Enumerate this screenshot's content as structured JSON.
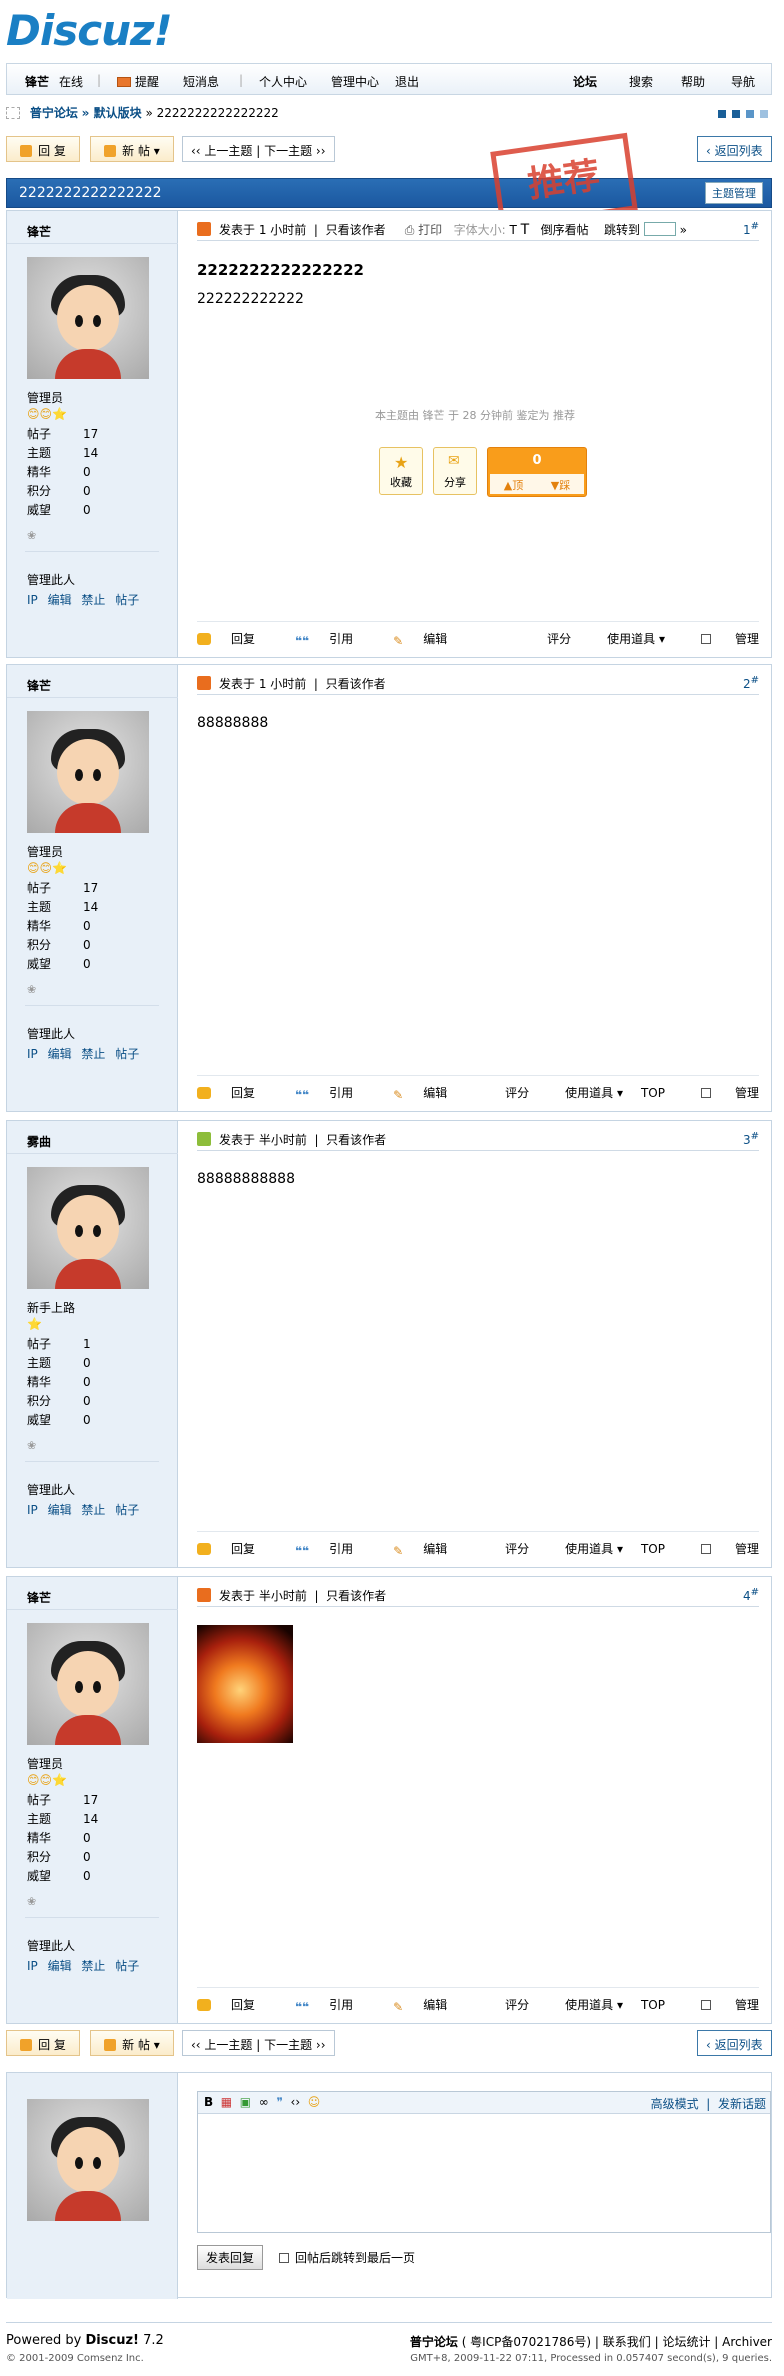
{
  "logo": "Discuz!",
  "topbar": {
    "user": "锋芒",
    "online": "在线",
    "reminder": "提醒",
    "pm": "短消息",
    "ucenter": "个人中心",
    "admincp": "管理中心",
    "logout": "退出",
    "forum": "论坛",
    "search": "搜索",
    "help": "帮助",
    "nav": "导航"
  },
  "crumb": {
    "site": "普宁论坛",
    "board": "» 默认版块",
    "thread": "» 2222222222222222"
  },
  "buttons": {
    "reply": "回 复",
    "newpost": "新 帖",
    "prevnext": "‹‹ 上一主题 | 下一主题 ››",
    "back": "‹ 返回列表"
  },
  "thread": {
    "title": "2222222222222222",
    "manage": "主题管理",
    "stamp": "推荐"
  },
  "labels": {
    "posts": "帖子",
    "threads": "主题",
    "digest": "精华",
    "credits": "积分",
    "prestige": "威望",
    "manage_user": "管理此人",
    "mlinks": "IP 编辑 禁止 帖子",
    "posted": "发表于",
    "only_author": "只看该作者",
    "print": "打印",
    "font": "字体大小:",
    "t": "T",
    "t2": "T",
    "reverse": "倒序看帖",
    "jump": "跳转到",
    "reply": "回复",
    "quote": "引用",
    "edit": "编辑",
    "rate": "评分",
    "tools": "使用道具",
    "top": "TOP",
    "admin": "管理",
    "fav": "收藏",
    "share": "分享",
    "up": "顶",
    "down": "踩"
  },
  "thread_hint": "本主题由 锋芒 于 28 分钟前 鉴定为 推荐",
  "posts": [
    {
      "author": "锋芒",
      "group": "管理员",
      "stars": "😊😊⭐",
      "time": "1 小时前",
      "only": "只看该作者",
      "floor": "1",
      "title": "2222222222222222",
      "content": "222222222222",
      "stats": [
        "17",
        "14",
        "0",
        "0",
        "0"
      ],
      "counter": "0",
      "green": false
    },
    {
      "author": "锋芒",
      "group": "管理员",
      "stars": "😊😊⭐",
      "time": "1 小时前",
      "only": "只看该作者",
      "floor": "2",
      "title": "",
      "content": "88888888",
      "stats": [
        "17",
        "14",
        "0",
        "0",
        "0"
      ],
      "green": false
    },
    {
      "author": "雾曲",
      "group": "新手上路",
      "stars": "⭐",
      "time": "半小时前",
      "only": "只看该作者",
      "floor": "3",
      "title": "",
      "content": "88888888888",
      "stats": [
        "1",
        "0",
        "0",
        "0",
        "0"
      ],
      "green": true
    },
    {
      "author": "锋芒",
      "group": "管理员",
      "stars": "😊😊⭐",
      "time": "半小时前",
      "only": "只看该作者",
      "floor": "4",
      "title": "",
      "content": "",
      "stats": [
        "17",
        "14",
        "0",
        "0",
        "0"
      ],
      "green": false
    }
  ],
  "reply_box": {
    "advanced": "高级模式",
    "newthread": "发新话题",
    "submit": "发表回复",
    "after": "回帖后跳转到最后一页"
  },
  "footer": {
    "powered": "Powered by",
    "brand": "Discuz!",
    "ver": "7.2",
    "copy": "© 2001-2009 Comsenz Inc.",
    "site": "普宁论坛",
    "icp": "( 粤ICP备07021786号)",
    "contact": "联系我们",
    "stats": "论坛统计",
    "archiver": "Archiver",
    "time": "GMT+8, 2009-11-22 07:11, Processed in 0.057407 second(s), 9 queries."
  }
}
